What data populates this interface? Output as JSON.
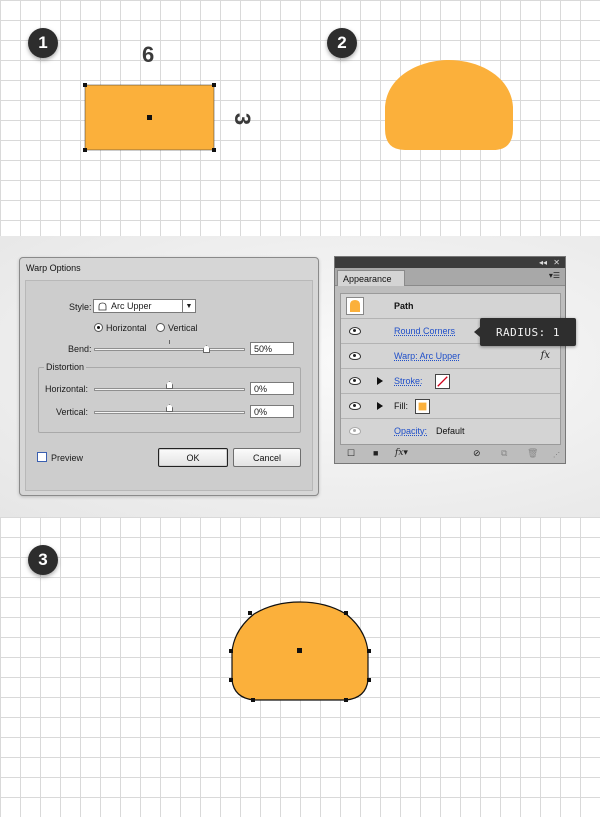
{
  "colors": {
    "fill": "#fbb03b",
    "grid": "#d9d9d9",
    "badge": "#2d2d2d"
  },
  "steps": {
    "step1": "1",
    "step2": "2",
    "step3": "3"
  },
  "dimensions": {
    "width": "6",
    "height": "3"
  },
  "warp_dialog": {
    "title": "Warp Options",
    "style_label": "Style:",
    "style_value": "Arc Upper",
    "horizontal_label": "Horizontal",
    "vertical_label": "Vertical",
    "orientation_selected": "Horizontal",
    "bend_label": "Bend:",
    "bend_value": "50%",
    "bend_fraction": 0.5,
    "distortion_label": "Distortion",
    "dist_horizontal_label": "Horizontal:",
    "dist_horizontal_value": "0%",
    "dist_vertical_label": "Vertical:",
    "dist_vertical_value": "0%",
    "preview_label": "Preview",
    "preview_checked": false,
    "ok_label": "OK",
    "cancel_label": "Cancel"
  },
  "appearance_panel": {
    "tab_label": "Appearance",
    "path_label": "Path",
    "rows": {
      "round_corners": "Round Corners",
      "warp": "Warp: Arc Upper",
      "stroke": "Stroke:",
      "fill": "Fill:",
      "opacity": "Opacity:",
      "opacity_value": "Default"
    }
  },
  "tooltip": "RADIUS: 1"
}
